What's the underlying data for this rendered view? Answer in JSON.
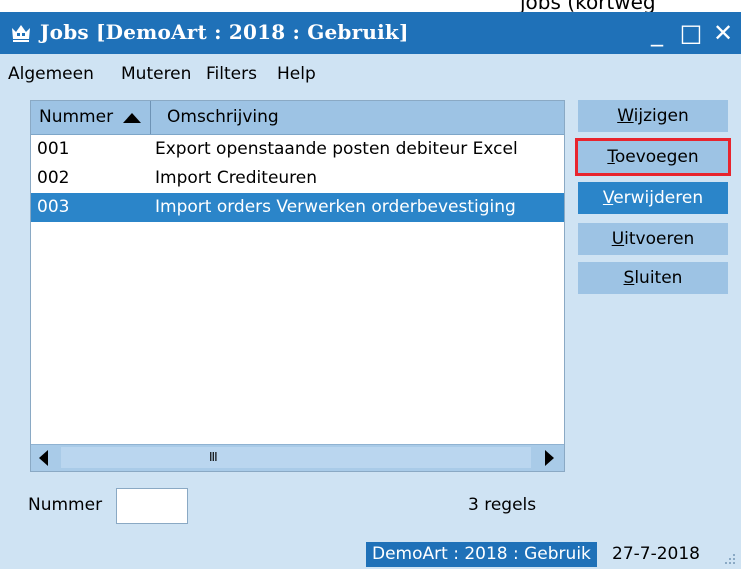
{
  "window": {
    "title": "Jobs [DemoArt : 2018 : Gebruik]",
    "minimize": "_",
    "maximize": "□",
    "close": "✕"
  },
  "menu": [
    "Algemeen",
    "Muteren",
    "Filters",
    "Help"
  ],
  "list": {
    "columns": [
      "Nummer",
      "Omschrijving"
    ],
    "sort": {
      "column": "Nummer",
      "direction": "ascending"
    },
    "rows": [
      {
        "nummer": "001",
        "omschrijving": "Export openstaande posten debiteur Excel",
        "selected": false
      },
      {
        "nummer": "002",
        "omschrijving": "Import Crediteuren",
        "selected": false
      },
      {
        "nummer": "003",
        "omschrijving": "Import orders Verwerken orderbevestiging",
        "selected": true
      }
    ],
    "scroll_grip": "III"
  },
  "buttons": [
    {
      "first": "W",
      "rest": "ijzigen",
      "underline_after": "",
      "label": "Wijzigen"
    },
    {
      "first": "T",
      "rest": "oevoegen",
      "label": "Toevoegen"
    },
    {
      "first": "V",
      "rest": "erwijderen",
      "label": "Verwijderen"
    },
    {
      "first": "U",
      "rest": "itvoeren",
      "label": "Uitvoeren"
    },
    {
      "first": "S",
      "rest": "luiten",
      "label": "Sluiten"
    }
  ],
  "footer": {
    "nummer_label": "Nummer",
    "nummer_value": "",
    "count_text": "3 regels"
  },
  "status": {
    "company": "DemoArt : 2018 : Gebruik",
    "date": "27-7-2018"
  },
  "colors": {
    "titlebar": "#1f71b8",
    "background": "#cfe3f3",
    "selected_row": "#2b85c9",
    "button": "#9dc3e4",
    "highlight_outline": "#e8242d"
  }
}
